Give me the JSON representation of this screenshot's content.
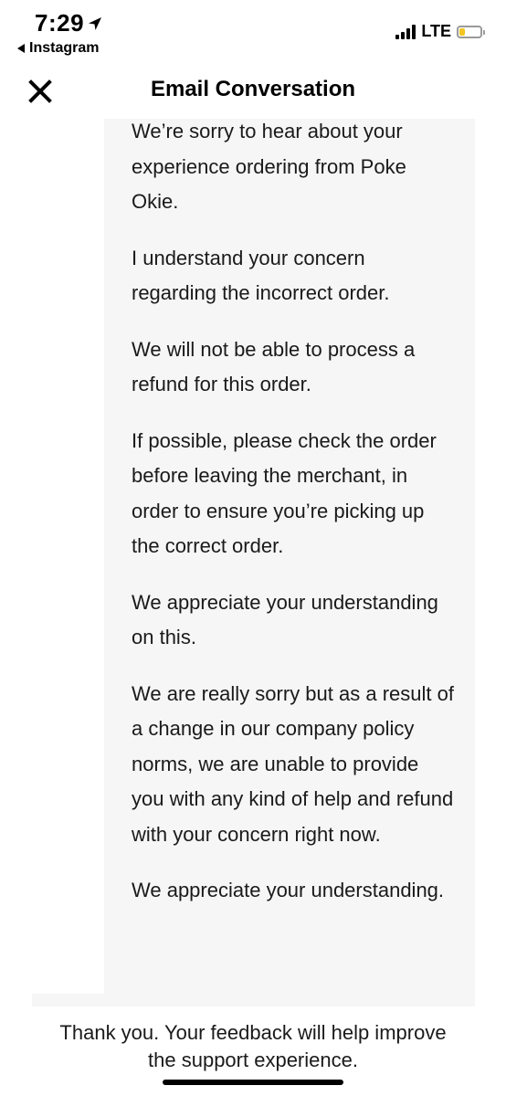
{
  "status_bar": {
    "time": "7:29",
    "back_app": "Instagram",
    "network": "LTE",
    "battery_level": 0.25,
    "location_icon": "location-arrow-icon",
    "signal_icon": "cellular-signal-icon"
  },
  "header": {
    "title": "Email Conversation",
    "close_icon": "close-icon"
  },
  "message": {
    "paragraphs": [
      "We’re sorry to hear about your experience ordering from Poke Okie.",
      "I understand your concern regarding the incorrect order.",
      "We will not be able to process a refund for this order.",
      "If possible, please check the order before leaving the merchant, in order to ensure you’re picking up the correct order.",
      "We appreciate your understanding on this.",
      "We are really sorry but as a result of a change in our company policy norms, we are unable to provide you with any kind of help and refund with your concern right now.",
      "We appreciate your understanding."
    ]
  },
  "footer": {
    "line1": "Thank you. Your feedback will help improve",
    "line2": "the support experience."
  }
}
